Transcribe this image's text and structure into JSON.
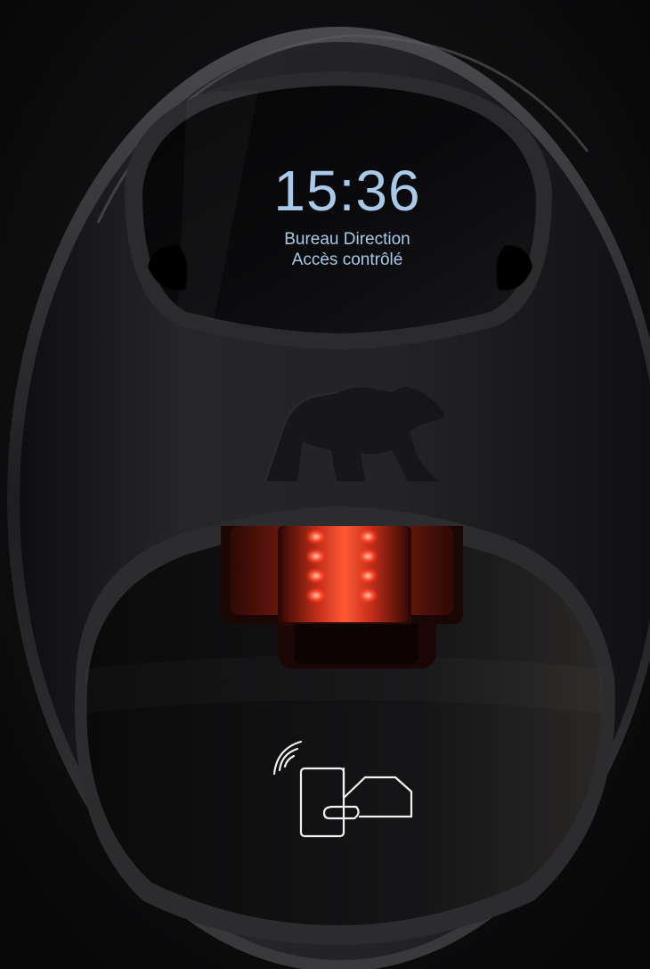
{
  "display": {
    "time": "15:36",
    "line1": "Bureau Direction",
    "line2": "Accès contrôlé"
  },
  "colors": {
    "background": "#0c0c0d",
    "body": "#1c1c1e",
    "screen_text": "#a9c9e8",
    "scanner_glow": "#ff3b1f",
    "icon_stroke": "#f2f2f2"
  },
  "icons": {
    "logo": "polar-bear-icon",
    "contactless": "contactless-card-icon"
  }
}
